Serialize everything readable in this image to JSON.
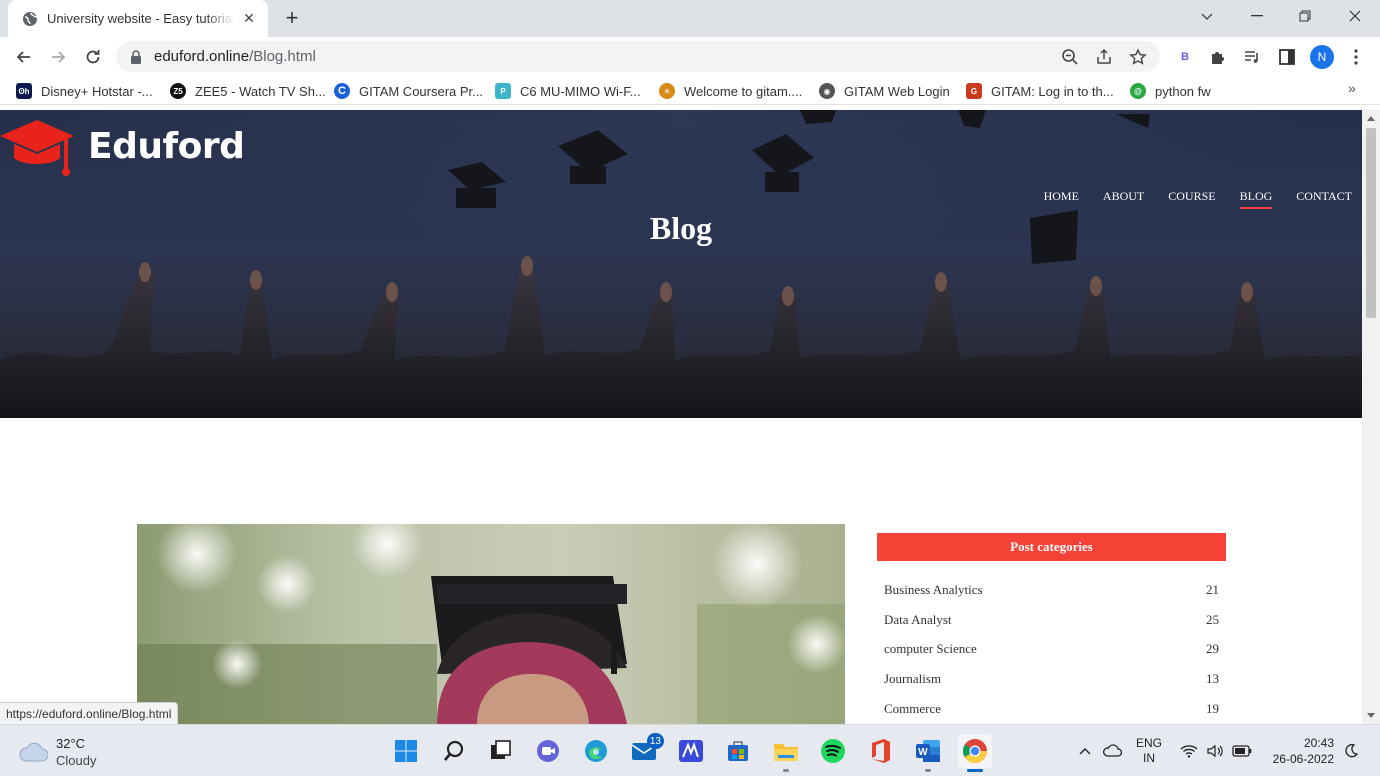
{
  "browser": {
    "tab_title": "University website - Easy tutorials",
    "url_domain": "eduford.online",
    "url_path": "/Blog.html",
    "profile_initial": "N",
    "extension_label": "B",
    "status_url": "https://eduford.online/Blog.html",
    "bookmarks": [
      {
        "label": "Disney+ Hotstar -...",
        "icon": "hotstar-icon",
        "color": "#0c1a4f"
      },
      {
        "label": "ZEE5 - Watch TV Sh...",
        "icon": "zee5-icon",
        "color": "#111111"
      },
      {
        "label": "GITAM Coursera Pr...",
        "icon": "coursera-icon",
        "color": "#1a5fd8"
      },
      {
        "label": "C6 MU-MIMO Wi-F...",
        "icon": "tplink-icon",
        "color": "#3cb5c9"
      },
      {
        "label": "Welcome to gitam....",
        "icon": "gitam-sun-icon",
        "color": "#d98a14"
      },
      {
        "label": "GITAM Web Login",
        "icon": "globe-icon",
        "color": "#555555"
      },
      {
        "label": "GITAM: Log in to th...",
        "icon": "gitam-logo-icon",
        "color": "#c83a1e"
      },
      {
        "label": "python fw",
        "icon": "spiral-icon",
        "color": "#2aa844"
      }
    ]
  },
  "site": {
    "brand": "Eduford",
    "nav": [
      "HOME",
      "ABOUT",
      "COURSE",
      "BLOG",
      "CONTACT"
    ],
    "active_nav": "BLOG",
    "hero_title": "Blog",
    "accent_color": "#f44336"
  },
  "sidebar": {
    "heading": "Post categories",
    "categories": [
      {
        "name": "Business Analytics",
        "count": "21"
      },
      {
        "name": "Data Analyst",
        "count": "25"
      },
      {
        "name": "computer Science",
        "count": "29"
      },
      {
        "name": "Journalism",
        "count": "13"
      },
      {
        "name": "Commerce",
        "count": "19"
      }
    ]
  },
  "taskbar": {
    "weather_temp": "32°C",
    "weather_desc": "Cloudy",
    "mail_badge": "13",
    "lang_line1": "ENG",
    "lang_line2": "IN",
    "time": "20:43",
    "date": "26-06-2022"
  }
}
